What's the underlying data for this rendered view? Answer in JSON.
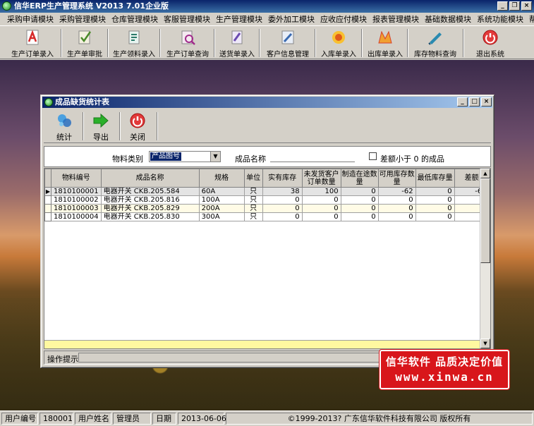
{
  "app": {
    "title": "信华ERP生产管理系统  V2013  7.01企业版"
  },
  "menu": [
    "采购申请模块",
    "采购管理模块",
    "仓库管理模块",
    "客服管理模块",
    "生产管理模块",
    "委外加工模块",
    "应收应付模块",
    "报表管理模块",
    "基础数据模块",
    "系统功能模块",
    "帮助"
  ],
  "toolbar": [
    {
      "label": "生产订单录入",
      "icon": "pdf-document-icon",
      "color": "#d62a2a"
    },
    {
      "label": "生产单审批",
      "icon": "approve-document-icon",
      "color": "#4a8a2a"
    },
    {
      "label": "生产领料录入",
      "icon": "pick-material-icon",
      "color": "#2a7a6a"
    },
    {
      "label": "生产订单查询",
      "icon": "order-query-icon",
      "color": "#a02a8a"
    },
    {
      "label": "送货单录入",
      "icon": "delivery-note-icon",
      "color": "#6a4ab0"
    },
    {
      "label": "客户信息管理",
      "icon": "customer-info-icon",
      "color": "#3a6ab0"
    },
    {
      "label": "入库单录入",
      "icon": "stock-in-icon",
      "color": "#e08a1a"
    },
    {
      "label": "出库单录入",
      "icon": "stock-out-icon",
      "color": "#d6402a"
    },
    {
      "label": "库存物料查询",
      "icon": "inventory-query-icon",
      "color": "#2a8ab0"
    },
    {
      "label": "退出系统",
      "icon": "exit-icon",
      "color": "#d62a2a"
    }
  ],
  "window": {
    "title": "成品缺货统计表",
    "tools": [
      {
        "label": "统计",
        "icon": "statistics-icon"
      },
      {
        "label": "导出",
        "icon": "export-arrow-icon"
      },
      {
        "label": "关闭",
        "icon": "close-power-icon"
      }
    ],
    "filter": {
      "category_label": "物料类别",
      "category_value": "产品图号",
      "name_label": "成品名称",
      "name_value": "",
      "diff_label": "差额小于 0 的成品",
      "diff_checked": false
    },
    "grid": {
      "columns": [
        "物料编号",
        "成品名称",
        "规格",
        "单位",
        "实有库存",
        "未发货客户订单数量",
        "制造在途数量",
        "可用库存数量",
        "最低库存量",
        "差额"
      ],
      "rows": [
        [
          "1810100001",
          "电器开关 CKB.205.584",
          "60A",
          "只",
          "38",
          "100",
          "0",
          "-62",
          "0",
          "-62"
        ],
        [
          "1810100002",
          "电器开关 CKB.205.816",
          "100A",
          "只",
          "0",
          "0",
          "0",
          "0",
          "0",
          "0"
        ],
        [
          "1810100003",
          "电器开关 CKB.205.829",
          "200A",
          "只",
          "0",
          "0",
          "0",
          "0",
          "0",
          "0"
        ],
        [
          "1810100004",
          "电器开关 CKB.205.830",
          "300A",
          "只",
          "0",
          "0",
          "0",
          "0",
          "0",
          "0"
        ]
      ]
    },
    "hint_label": "操作提示"
  },
  "stamp": {
    "line1": "信华软件 品质决定价值",
    "line2": "www.xinwa.cn"
  },
  "status": [
    {
      "text": "用户编号"
    },
    {
      "text": "180001"
    },
    {
      "text": "用户姓名"
    },
    {
      "text": "管理员"
    },
    {
      "text": "日期"
    },
    {
      "text": "2013-06-06"
    },
    {
      "text": "©1999-2013?  广东信华软件科技有限公司  版权所有"
    }
  ]
}
